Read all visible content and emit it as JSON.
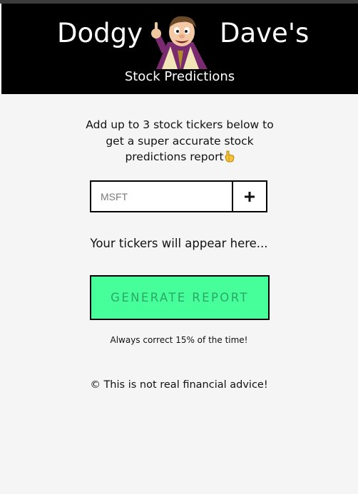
{
  "header": {
    "brand_left": "Dodgy",
    "brand_right": "Dave's",
    "subtitle": "Stock Predictions",
    "mascot_icon": "cartoon-mascot-dave",
    "background_color": "#000000"
  },
  "intro": {
    "text": "Add up to 3 stock tickers below to get a super accurate stock predictions report",
    "emoji_icon": "pointing-down-hand-icon"
  },
  "ticker_form": {
    "input_value": "",
    "input_placeholder": "MSFT",
    "add_button_icon": "plus-icon"
  },
  "tickers_display": {
    "placeholder_text": "Your tickers will appear here..."
  },
  "generate_button": {
    "label": "GENERATE REPORT",
    "background_color": "#46ff9a"
  },
  "tagline": "Always correct 15% of the time!",
  "footer": {
    "text": "© This is not real financial advice!"
  }
}
